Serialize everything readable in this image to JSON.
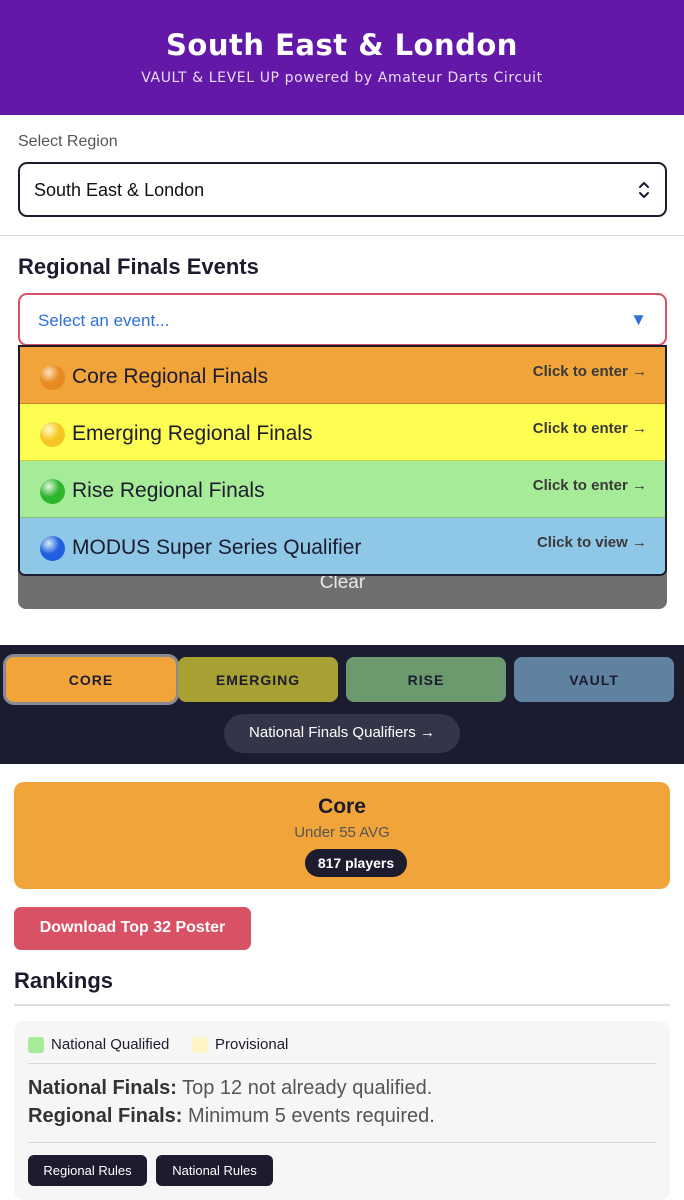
{
  "header": {
    "title": "South East & London",
    "subtitle": "VAULT & LEVEL UP powered by Amateur Darts Circuit"
  },
  "region": {
    "label": "Select Region",
    "selected": "South East & London"
  },
  "events": {
    "title": "Regional Finals Events",
    "placeholder": "Select an event...",
    "arrow": "▼",
    "options": [
      {
        "name": "Core Regional Finals",
        "cta": "Click to enter →",
        "bg": "#f0a43a",
        "dot": "#e88a1f"
      },
      {
        "name": "Emerging Regional Finals",
        "cta": "Click to enter →",
        "bg": "#fdfd52",
        "dot": "#f5c623"
      },
      {
        "name": "Rise Regional Finals",
        "cta": "Click to enter →",
        "bg": "#a6eb97",
        "dot": "#2db52d"
      },
      {
        "name": "MODUS Super Series Qualifier",
        "cta": "Click to view →",
        "bg": "#8fc8e7",
        "dot": "#1f5fe0"
      }
    ],
    "clear_label": "Clear"
  },
  "tabs": {
    "items": [
      {
        "label": "CORE",
        "color": "#f0a43a",
        "active": true
      },
      {
        "label": "EMERGING",
        "color": "#a7a033",
        "active": false
      },
      {
        "label": "RISE",
        "color": "#6a9a6e",
        "active": false
      },
      {
        "label": "VAULT",
        "color": "#5f82a0",
        "active": false
      }
    ],
    "nfq_label": "National Finals Qualifiers →"
  },
  "category": {
    "title": "Core",
    "subtitle": "Under 55 AVG",
    "players": "817 players"
  },
  "download_label": "Download Top 32 Poster",
  "rankings": {
    "title": "Rankings",
    "legend": [
      {
        "label": "National Qualified",
        "color": "#a6eb97"
      },
      {
        "label": "Provisional",
        "color": "#fdf6c4"
      }
    ],
    "national_label": "National Finals:",
    "national_text": "Top 12 not already qualified.",
    "regional_label": "Regional Finals:",
    "regional_text": "Minimum 5 events required.",
    "regional_rules_label": "Regional Rules",
    "national_rules_label": "National Rules"
  },
  "colors": {
    "header_bg": "#6318a8",
    "dark": "#1c1c2e",
    "accent_red": "#d95164",
    "link_blue": "#2f6fd6"
  }
}
